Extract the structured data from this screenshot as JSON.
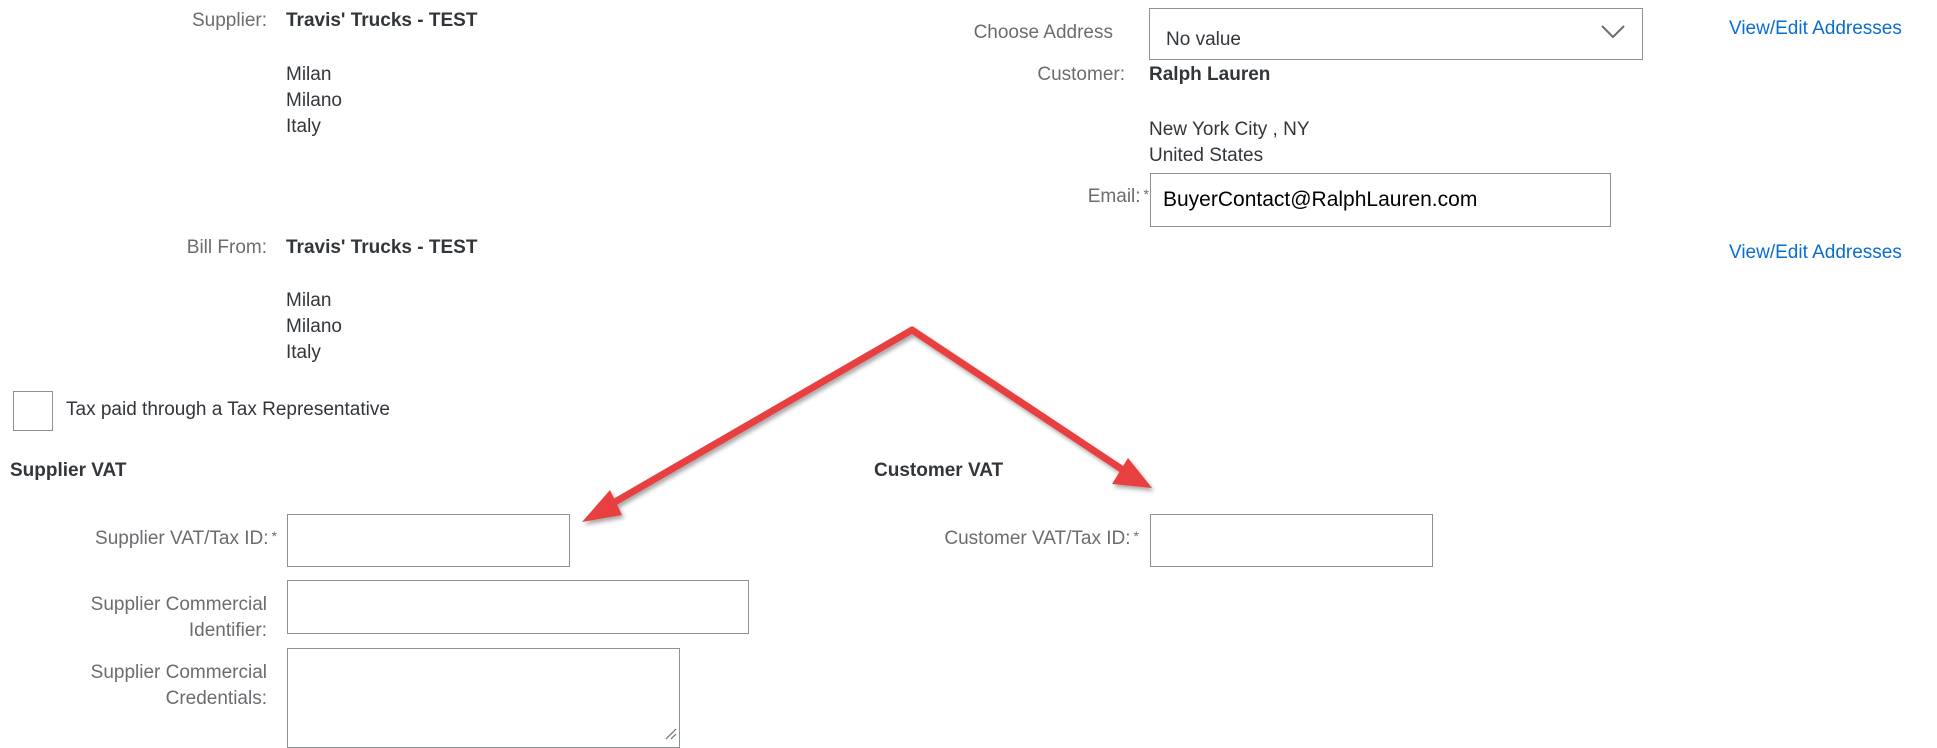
{
  "supplier": {
    "label": "Supplier:",
    "name": "Travis' Trucks - TEST",
    "address": [
      "Milan",
      "Milano",
      "Italy"
    ]
  },
  "choose_address": {
    "label": "Choose Address",
    "value": "No value",
    "link": "View/Edit Addresses"
  },
  "customer": {
    "label": "Customer:",
    "name": "Ralph Lauren",
    "address": [
      "New York City , NY",
      "United States"
    ]
  },
  "email": {
    "label": "Email:",
    "required_mark": "*",
    "value": "BuyerContact@RalphLauren.com"
  },
  "bill_from": {
    "label": "Bill From:",
    "name": "Travis' Trucks - TEST",
    "address": [
      "Milan",
      "Milano",
      "Italy"
    ],
    "link": "View/Edit Addresses"
  },
  "tax_rep": {
    "label": "Tax paid through a Tax Representative",
    "checked": false
  },
  "supplier_vat": {
    "heading": "Supplier VAT",
    "tax_id_label": "Supplier VAT/Tax ID:",
    "required_mark": "*",
    "tax_id_value": "",
    "commercial_id_label_line1": "Supplier Commercial",
    "commercial_id_label_line2": "Identifier:",
    "commercial_id_value": "",
    "credentials_label_line1": "Supplier Commercial",
    "credentials_label_line2": "Credentials:",
    "credentials_value": ""
  },
  "customer_vat": {
    "heading": "Customer VAT",
    "tax_id_label": "Customer VAT/Tax ID:",
    "required_mark": "*",
    "tax_id_value": ""
  },
  "colors": {
    "link": "#0a6ed1",
    "label": "#6a6d70",
    "text": "#32363a",
    "arrow": "#e8403f",
    "border": "#89919a"
  }
}
